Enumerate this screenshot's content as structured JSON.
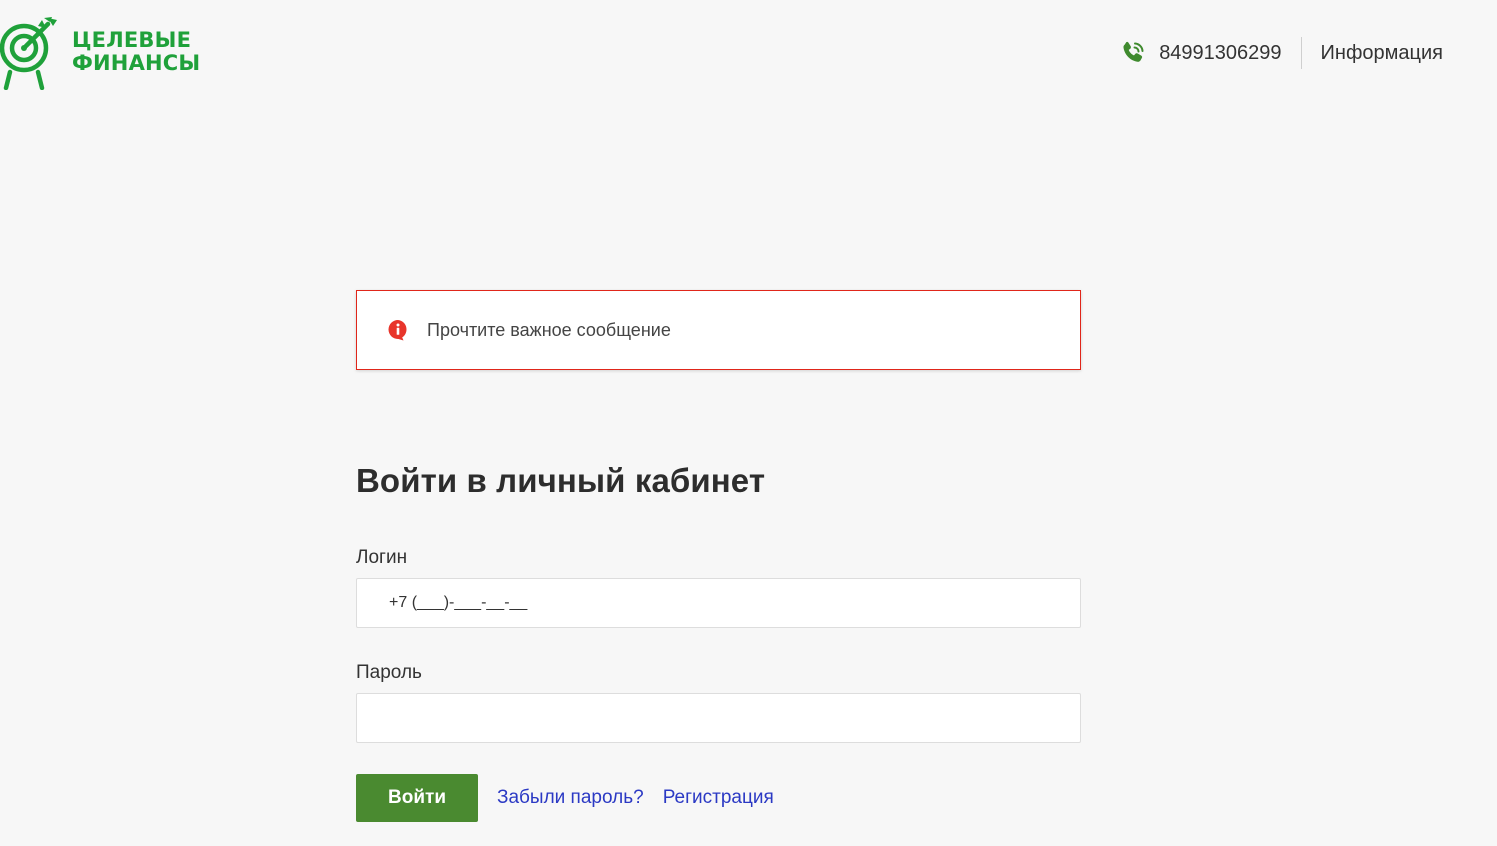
{
  "header": {
    "logo": {
      "line1": "ЦЕЛЕВЫЕ",
      "line2": "ФИНАНСЫ",
      "icon": "target-arrow-icon"
    },
    "phone": {
      "icon": "phone-icon",
      "number": "84991306299"
    },
    "info_label": "Информация"
  },
  "alert": {
    "icon": "info-alert-icon",
    "text": "Прочтите важное сообщение"
  },
  "login": {
    "title": "Войти в личный кабинет",
    "login_label": "Логин",
    "login_value": "+7 (___)-___-__-__",
    "password_label": "Пароль",
    "password_value": "",
    "submit_label": "Войти",
    "forgot_label": "Забыли пароль?",
    "register_label": "Регистрация"
  },
  "colors": {
    "brand_green": "#1fa13a",
    "button_green": "#4a8a30",
    "alert_red": "#e0261a",
    "link_blue": "#2b39c4",
    "background": "#f7f7f7"
  }
}
